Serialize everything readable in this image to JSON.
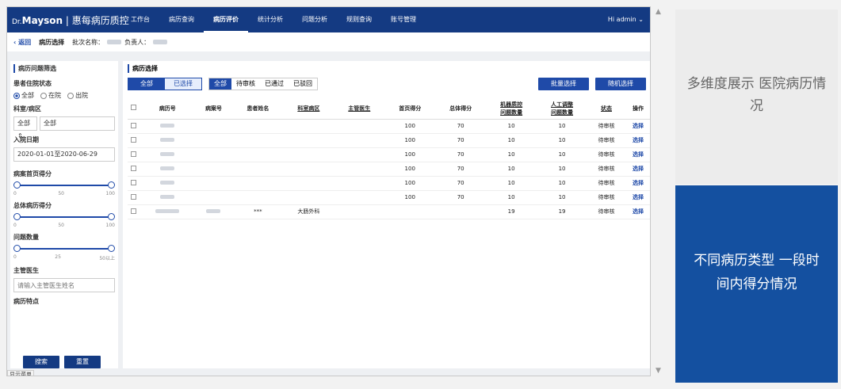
{
  "app": {
    "logo_dr": "Dr.",
    "logo_brand": "Mayson",
    "logo_title": "| 惠每病历质控",
    "greeting": "Hi  admin"
  },
  "nav": [
    "工作台",
    "病历查询",
    "病历评价",
    "统计分析",
    "问题分析",
    "规则查询",
    "账号管理"
  ],
  "nav_active": 2,
  "breadcrumb": {
    "back": "返回",
    "current": "病历选择",
    "batch_label": "批次名称：",
    "owner_label": "负责人："
  },
  "sidebar": {
    "title": "病历问题筛选",
    "status_label": "患者住院状态",
    "status_options": [
      "全部",
      "在院",
      "出院"
    ],
    "dept_label": "科室/病区",
    "dept_select_a": "全部",
    "dept_select_b": "全部",
    "date_label": "入院日期",
    "date_value": "2020-01-01至2020-06-29",
    "score1_label": "病案首页得分",
    "score1_ticks": [
      "0",
      "50",
      "100"
    ],
    "score2_label": "总体病历得分",
    "score2_ticks": [
      "0",
      "50",
      "100"
    ],
    "issue_label": "问题数量",
    "issue_ticks": [
      "0",
      "25",
      "50以上"
    ],
    "doctor_label": "主管医生",
    "doctor_placeholder": "请输入主管医生姓名",
    "feature_label": "病历特点",
    "search_btn": "搜索",
    "reset_btn": "重置",
    "toggle": "显示菜单"
  },
  "main": {
    "title": "病历选择",
    "seg": [
      "全部",
      "已选择"
    ],
    "status_tabs": [
      "全部",
      "待审核",
      "已通过",
      "已驳回"
    ],
    "batch_btn": "批量选择",
    "random_btn": "随机选择",
    "columns": [
      "病历号",
      "病案号",
      "患者姓名",
      "科室病区",
      "主管医生",
      "首页得分",
      "总体得分",
      "机器质控\n问题数量",
      "人工调整\n问题数量",
      "状态",
      "操作"
    ],
    "rows": [
      [
        "",
        "",
        "",
        "",
        "",
        "100",
        "70",
        "10",
        "10",
        "待审核",
        "选择"
      ],
      [
        "",
        "",
        "",
        "",
        "",
        "100",
        "70",
        "10",
        "10",
        "待审核",
        "选择"
      ],
      [
        "",
        "",
        "",
        "",
        "",
        "100",
        "70",
        "10",
        "10",
        "待审核",
        "选择"
      ],
      [
        "",
        "",
        "",
        "",
        "",
        "100",
        "70",
        "10",
        "10",
        "待审核",
        "选择"
      ],
      [
        "",
        "",
        "",
        "",
        "",
        "100",
        "70",
        "10",
        "10",
        "待审核",
        "选择"
      ],
      [
        "",
        "",
        "",
        "",
        "",
        "100",
        "70",
        "10",
        "10",
        "待审核",
        "选择"
      ],
      [
        "",
        "",
        "***",
        "大肠外科",
        "",
        "",
        "",
        "19",
        "19",
        "待审核",
        "选择"
      ]
    ]
  },
  "cards": {
    "card1": "多维度展示 医院病历情况",
    "card2": "不同病历类型 一段时间内得分情况"
  },
  "colors": {
    "nav": "#143a82",
    "accent": "#1f4aa8",
    "card2": "#1450a0",
    "card1": "#ececec"
  }
}
